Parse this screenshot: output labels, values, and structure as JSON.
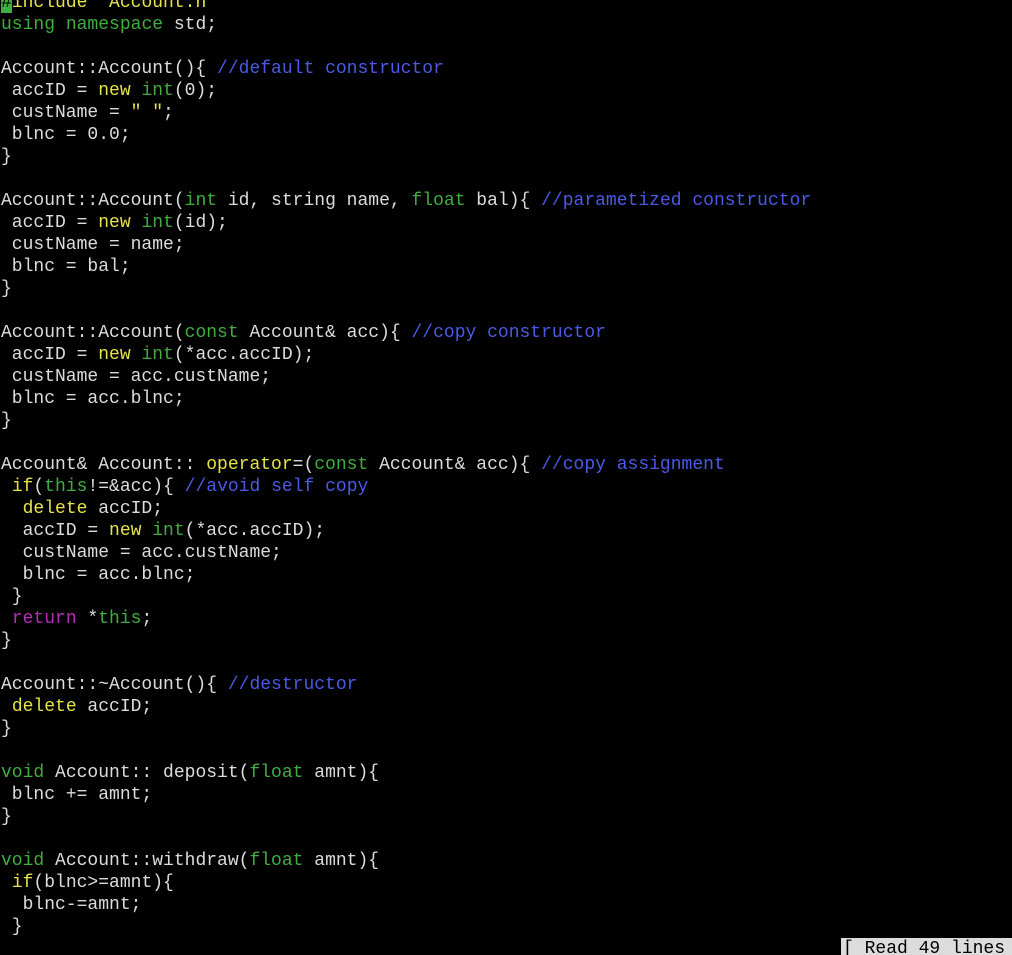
{
  "app": "terminal-text-editor",
  "colors": {
    "background": "#000000",
    "plain": "#dcdcdc",
    "keyword": "#e6e24a",
    "type": "#3fae3f",
    "string": "#e6e24a",
    "comment": "#4a5ae6",
    "control_flow": "#b52db5",
    "cursor": "#3fae3f",
    "status_bar": "#dcdcdc"
  },
  "lines": [
    [
      [
        "cursor",
        "#"
      ],
      [
        "kw",
        "include"
      ],
      [
        "plain",
        " "
      ],
      [
        "str",
        "\"Account.h\""
      ]
    ],
    [
      [
        "type",
        "using"
      ],
      [
        "plain",
        " "
      ],
      [
        "type",
        "namespace"
      ],
      [
        "plain",
        " std;"
      ]
    ],
    [],
    [
      [
        "plain",
        "Account::Account(){ "
      ],
      [
        "comment",
        "//default constructor"
      ]
    ],
    [
      [
        "plain",
        " accID = "
      ],
      [
        "kw",
        "new"
      ],
      [
        "plain",
        " "
      ],
      [
        "type",
        "int"
      ],
      [
        "plain",
        "(0);"
      ]
    ],
    [
      [
        "plain",
        " custName = "
      ],
      [
        "str",
        "\" \""
      ],
      [
        "plain",
        ";"
      ]
    ],
    [
      [
        "plain",
        " blnc = 0.0;"
      ]
    ],
    [
      [
        "plain",
        "}"
      ]
    ],
    [],
    [
      [
        "plain",
        "Account::Account("
      ],
      [
        "type",
        "int"
      ],
      [
        "plain",
        " id, string name, "
      ],
      [
        "type",
        "float"
      ],
      [
        "plain",
        " bal){ "
      ],
      [
        "comment",
        "//parametized constructor"
      ]
    ],
    [
      [
        "plain",
        " accID = "
      ],
      [
        "kw",
        "new"
      ],
      [
        "plain",
        " "
      ],
      [
        "type",
        "int"
      ],
      [
        "plain",
        "(id);"
      ]
    ],
    [
      [
        "plain",
        " custName = name;"
      ]
    ],
    [
      [
        "plain",
        " blnc = bal;"
      ]
    ],
    [
      [
        "plain",
        "}"
      ]
    ],
    [],
    [
      [
        "plain",
        "Account::Account("
      ],
      [
        "type",
        "const"
      ],
      [
        "plain",
        " Account& acc){ "
      ],
      [
        "comment",
        "//copy constructor"
      ]
    ],
    [
      [
        "plain",
        " accID = "
      ],
      [
        "kw",
        "new"
      ],
      [
        "plain",
        " "
      ],
      [
        "type",
        "int"
      ],
      [
        "plain",
        "(*acc.accID);"
      ]
    ],
    [
      [
        "plain",
        " custName = acc.custName;"
      ]
    ],
    [
      [
        "plain",
        " blnc = acc.blnc;"
      ]
    ],
    [
      [
        "plain",
        "}"
      ]
    ],
    [],
    [
      [
        "plain",
        "Account& Account:: "
      ],
      [
        "kw",
        "operator"
      ],
      [
        "plain",
        "=("
      ],
      [
        "type",
        "const"
      ],
      [
        "plain",
        " Account& acc){ "
      ],
      [
        "comment",
        "//copy assignment"
      ]
    ],
    [
      [
        "plain",
        " "
      ],
      [
        "kw",
        "if"
      ],
      [
        "plain",
        "("
      ],
      [
        "type",
        "this"
      ],
      [
        "plain",
        "!=&acc){ "
      ],
      [
        "comment",
        "//avoid self copy"
      ]
    ],
    [
      [
        "plain",
        "  "
      ],
      [
        "kw",
        "delete"
      ],
      [
        "plain",
        " accID;"
      ]
    ],
    [
      [
        "plain",
        "  accID = "
      ],
      [
        "kw",
        "new"
      ],
      [
        "plain",
        " "
      ],
      [
        "type",
        "int"
      ],
      [
        "plain",
        "(*acc.accID);"
      ]
    ],
    [
      [
        "plain",
        "  custName = acc.custName;"
      ]
    ],
    [
      [
        "plain",
        "  blnc = acc.blnc;"
      ]
    ],
    [
      [
        "plain",
        " }"
      ]
    ],
    [
      [
        "plain",
        " "
      ],
      [
        "flow",
        "return"
      ],
      [
        "plain",
        " *"
      ],
      [
        "type",
        "this"
      ],
      [
        "plain",
        ";"
      ]
    ],
    [
      [
        "plain",
        "}"
      ]
    ],
    [],
    [
      [
        "plain",
        "Account::~Account(){ "
      ],
      [
        "comment",
        "//destructor"
      ]
    ],
    [
      [
        "plain",
        " "
      ],
      [
        "kw",
        "delete"
      ],
      [
        "plain",
        " accID;"
      ]
    ],
    [
      [
        "plain",
        "}"
      ]
    ],
    [],
    [
      [
        "type",
        "void"
      ],
      [
        "plain",
        " Account:: deposit("
      ],
      [
        "type",
        "float"
      ],
      [
        "plain",
        " amnt){"
      ]
    ],
    [
      [
        "plain",
        " blnc += amnt;"
      ]
    ],
    [
      [
        "plain",
        "}"
      ]
    ],
    [],
    [
      [
        "type",
        "void"
      ],
      [
        "plain",
        " Account::withdraw("
      ],
      [
        "type",
        "float"
      ],
      [
        "plain",
        " amnt){"
      ]
    ],
    [
      [
        "plain",
        " "
      ],
      [
        "kw",
        "if"
      ],
      [
        "plain",
        "(blnc>=amnt){"
      ]
    ],
    [
      [
        "plain",
        "  blnc-=amnt;"
      ]
    ],
    [
      [
        "plain",
        " }"
      ]
    ]
  ],
  "status": {
    "message": "[ Read 49 lines ]"
  }
}
